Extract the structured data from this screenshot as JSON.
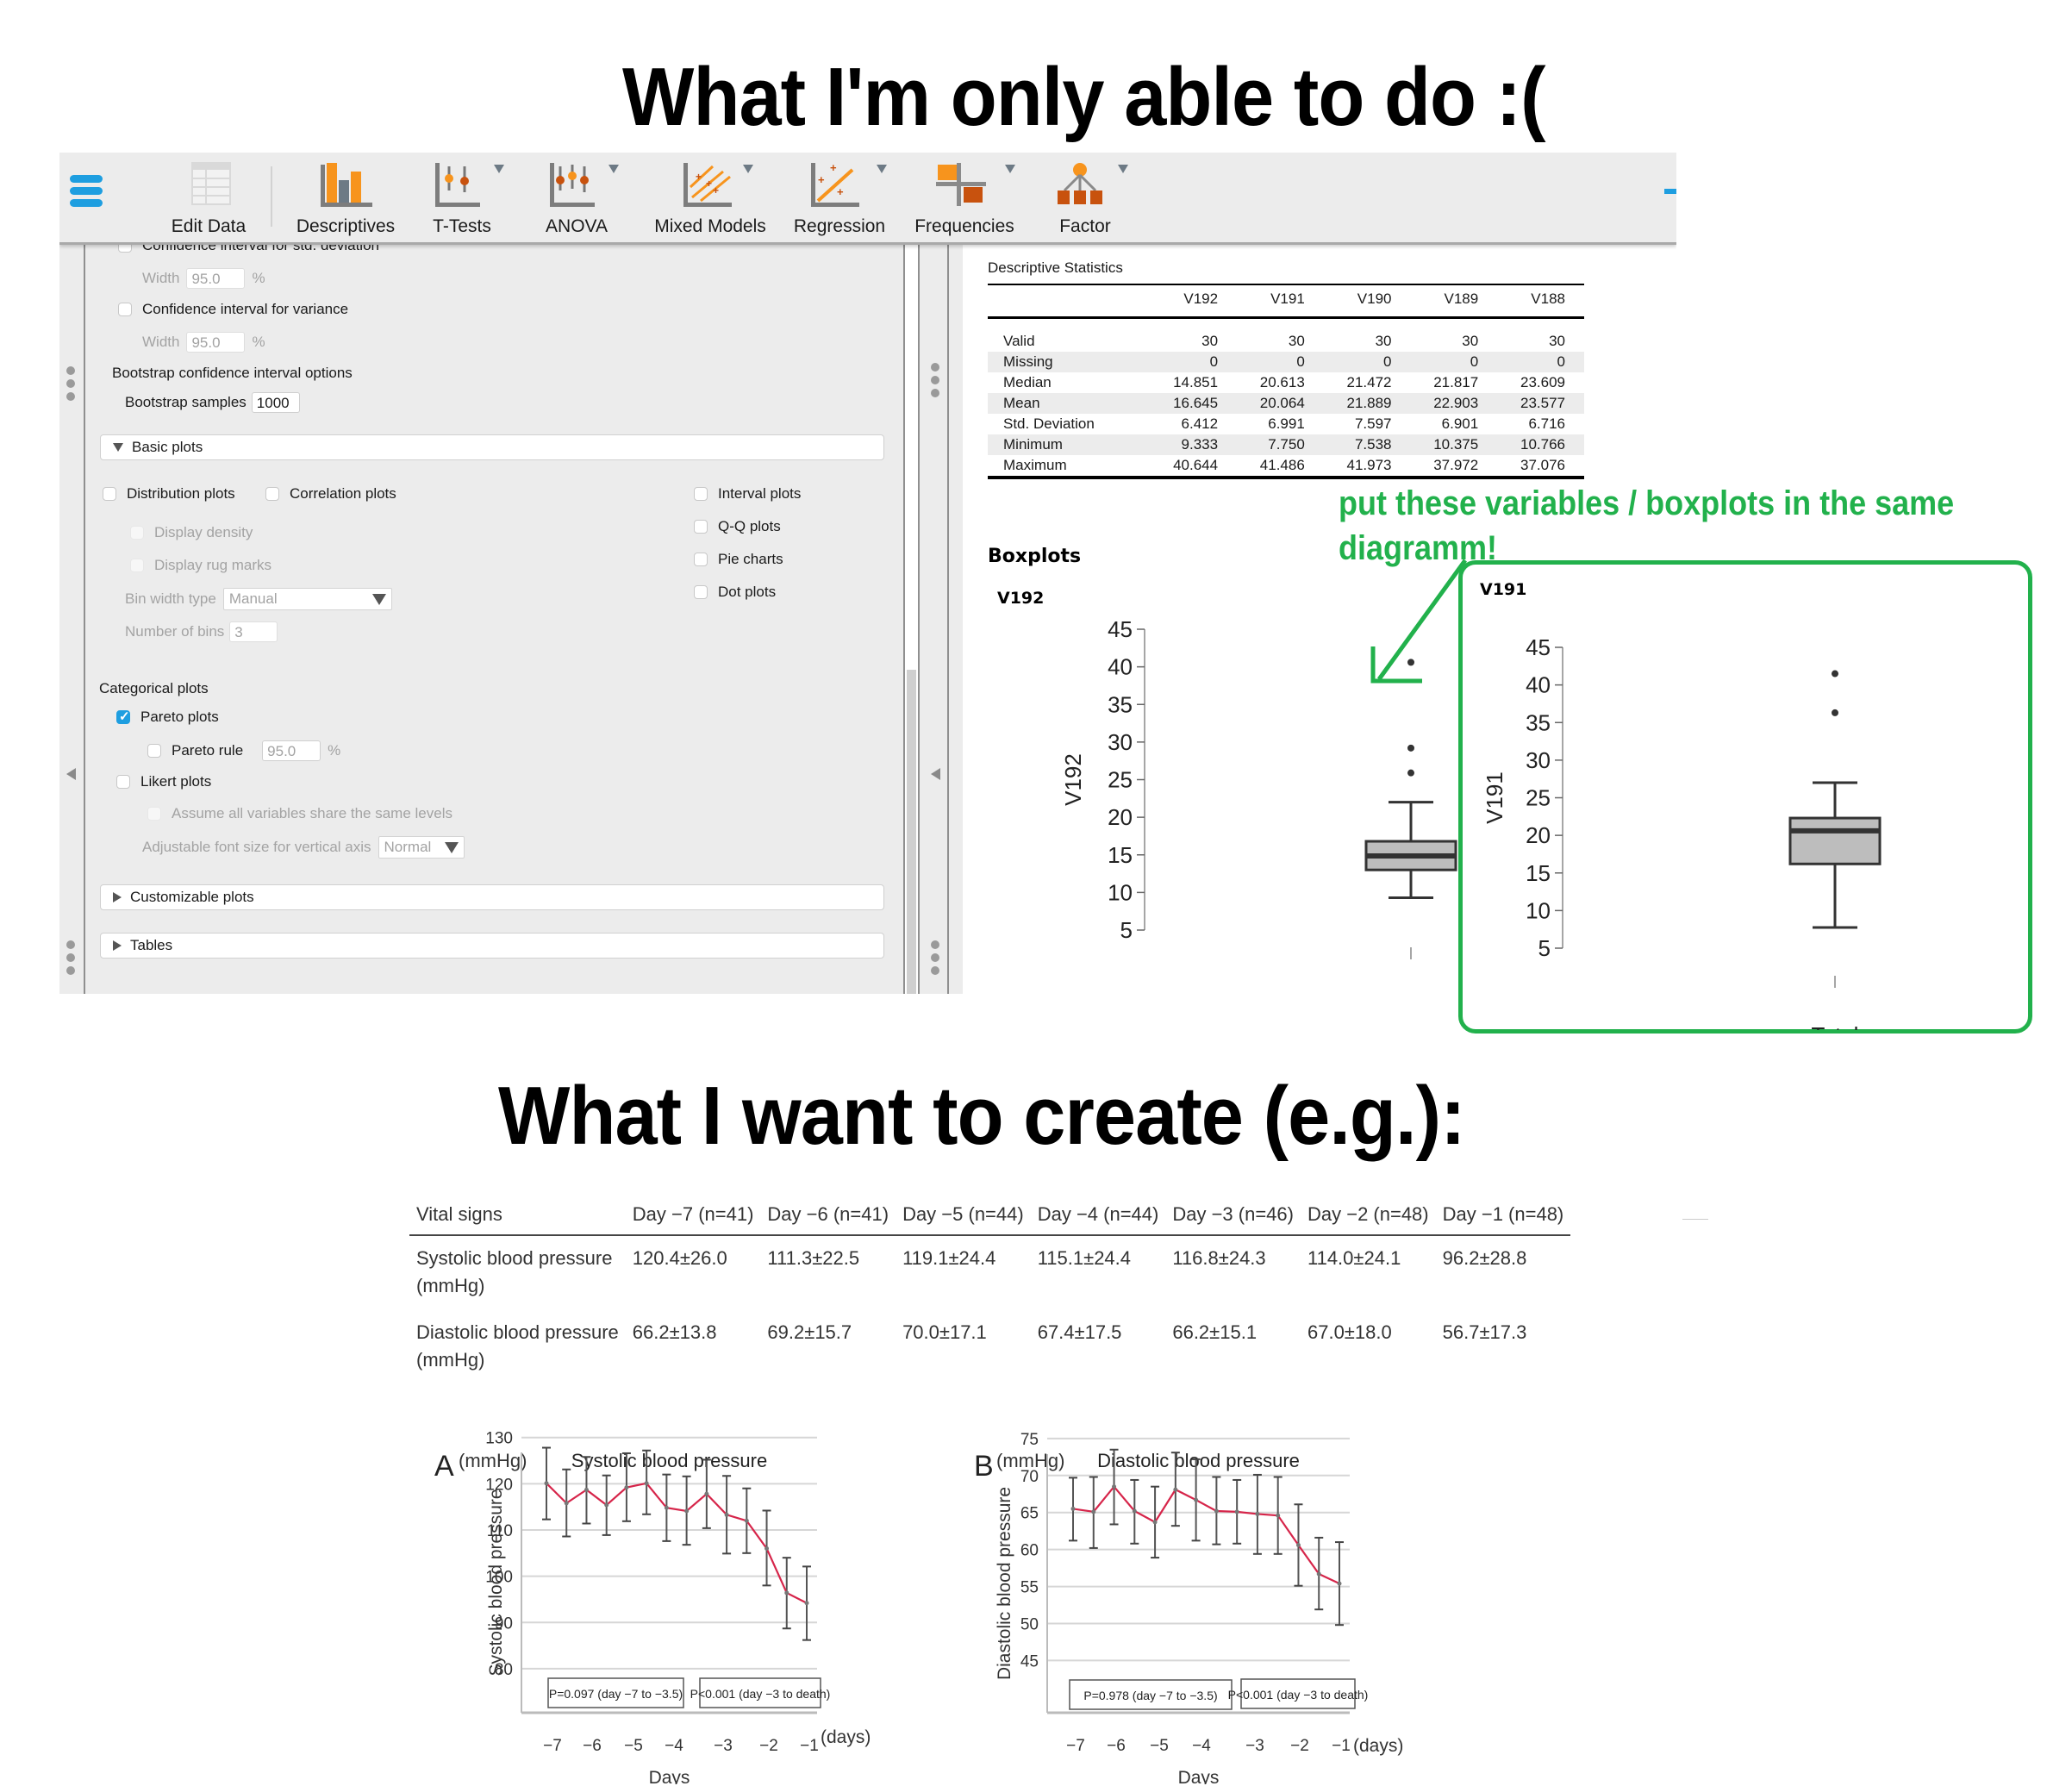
{
  "titles": {
    "top": "What I'm only able to do :(",
    "bottom": "What I want to create (e.g.):"
  },
  "toolbar": {
    "menu_icon": "hamburger-menu-icon",
    "items": [
      {
        "label": "Edit Data",
        "icon": "edit-data-grid-icon",
        "has_menu": false
      },
      {
        "label": "Descriptives",
        "icon": "descriptives-bar-icon",
        "has_menu": false
      },
      {
        "label": "T-Tests",
        "icon": "t-tests-icon",
        "has_menu": true
      },
      {
        "label": "ANOVA",
        "icon": "anova-icon",
        "has_menu": true
      },
      {
        "label": "Mixed Models",
        "icon": "mixed-models-icon",
        "has_menu": true
      },
      {
        "label": "Regression",
        "icon": "regression-icon",
        "has_menu": true
      },
      {
        "label": "Frequencies",
        "icon": "frequencies-icon",
        "has_menu": true
      },
      {
        "label": "Factor",
        "icon": "factor-icon",
        "has_menu": true
      }
    ]
  },
  "options": {
    "ci_std_dev": {
      "label": "Confidence interval for std. deviation",
      "checked": false
    },
    "ci_std_dev_width": {
      "label": "Width",
      "value": "95.0",
      "unit": "%"
    },
    "ci_variance": {
      "label": "Confidence interval for variance",
      "checked": false
    },
    "ci_variance_width": {
      "label": "Width",
      "value": "95.0",
      "unit": "%"
    },
    "bootstrap_heading": "Bootstrap confidence interval options",
    "bootstrap_samples": {
      "label": "Bootstrap samples",
      "value": "1000"
    },
    "basic_plots": {
      "label": "Basic plots",
      "distribution_plots": "Distribution plots",
      "correlation_plots": "Correlation plots",
      "interval_plots": "Interval plots",
      "qq_plots": "Q-Q plots",
      "pie_charts": "Pie charts",
      "dot_plots": "Dot plots",
      "display_density": "Display density",
      "display_rug_marks": "Display rug marks",
      "bin_width_type": {
        "label": "Bin width type",
        "value": "Manual"
      },
      "number_of_bins": {
        "label": "Number of bins",
        "value": "3"
      }
    },
    "categorical_plots": {
      "heading": "Categorical plots",
      "pareto_plots": {
        "label": "Pareto plots",
        "checked": true
      },
      "pareto_rule": {
        "label": "Pareto rule",
        "value": "95.0",
        "unit": "%"
      },
      "likert_plots": {
        "label": "Likert plots",
        "checked": false
      },
      "assume_same_levels": "Assume all variables share the same levels",
      "font_size_vertical": {
        "label": "Adjustable font size for vertical axis",
        "value": "Normal"
      }
    },
    "customizable_plots": "Customizable plots",
    "tables": "Tables"
  },
  "results": {
    "table_title": "Descriptive Statistics",
    "columns": [
      "",
      "V192",
      "V191",
      "V190",
      "V189",
      "V188"
    ],
    "rows": [
      [
        "Valid",
        "30",
        "30",
        "30",
        "30",
        "30"
      ],
      [
        "Missing",
        "0",
        "0",
        "0",
        "0",
        "0"
      ],
      [
        "Median",
        "14.851",
        "20.613",
        "21.472",
        "21.817",
        "23.609"
      ],
      [
        "Mean",
        "16.645",
        "20.064",
        "21.889",
        "22.903",
        "23.577"
      ],
      [
        "Std. Deviation",
        "6.412",
        "6.991",
        "7.597",
        "6.901",
        "6.716"
      ],
      [
        "Minimum",
        "9.333",
        "7.750",
        "7.538",
        "10.375",
        "10.766"
      ],
      [
        "Maximum",
        "40.644",
        "41.486",
        "41.973",
        "37.972",
        "37.076"
      ]
    ],
    "boxplots_heading": "Boxplots",
    "annotation": {
      "line1": "put these variables / boxplots in the same",
      "line2": "diagramm!",
      "color": "#22b14c"
    }
  },
  "vital_table": {
    "columns": [
      "Vital signs",
      "Day −7 (n=41)",
      "Day −6 (n=41)",
      "Day −5 (n=44)",
      "Day −4 (n=44)",
      "Day −3 (n=46)",
      "Day −2 (n=48)",
      "Day −1 (n=48)"
    ],
    "rows": [
      {
        "label1": "Systolic blood pressure",
        "label2": "(mmHg)",
        "values": [
          "120.4±26.0",
          "111.3±22.5",
          "119.1±24.4",
          "115.1±24.4",
          "116.8±24.3",
          "114.0±24.1",
          "96.2±28.8"
        ]
      },
      {
        "label1": "Diastolic blood pressure",
        "label2": "(mmHg)",
        "values": [
          "66.2±13.8",
          "69.2±15.7",
          "70.0±17.1",
          "67.4±17.5",
          "66.2±15.1",
          "67.0±18.0",
          "56.7±17.3"
        ]
      }
    ]
  },
  "chart_data": [
    {
      "id": "boxplot-v192",
      "type": "boxplot",
      "title": "V192",
      "ylabel": "V192",
      "xlabel": "",
      "yticks": [
        5,
        10,
        15,
        20,
        25,
        30,
        35,
        40,
        45
      ],
      "ylim": [
        5,
        45
      ],
      "box": {
        "whisker_low": 9.3,
        "q1": 13.0,
        "median": 14.85,
        "q3": 16.8,
        "whisker_high": 22.0
      },
      "outliers": [
        25.9,
        29.2,
        40.6
      ]
    },
    {
      "id": "boxplot-v191",
      "type": "boxplot",
      "title": "V191",
      "ylabel": "V191",
      "xlabel": "Total",
      "yticks": [
        5,
        10,
        15,
        20,
        25,
        30,
        35,
        40,
        45
      ],
      "ylim": [
        5,
        45
      ],
      "box": {
        "whisker_low": 7.75,
        "q1": 16.2,
        "median": 20.6,
        "q3": 22.3,
        "whisker_high": 27.0
      },
      "outliers": [
        36.3,
        41.5
      ]
    },
    {
      "id": "chart-a",
      "type": "line",
      "panel_label": "A",
      "unit_label": "(mmHg)",
      "title": "Systolic blood pressure",
      "ylabel": "Systolic blood pressure",
      "xlabel": "Days",
      "x_unit": "(days)",
      "xticks": [
        "−7",
        "−6",
        "−5",
        "−4",
        "−3",
        "−2",
        "−1"
      ],
      "yticks": [
        80,
        90,
        100,
        110,
        120,
        130
      ],
      "ylim": [
        77,
        132
      ],
      "grid": true,
      "series": [
        {
          "name": "Systolic blood pressure",
          "color": "#d6254a",
          "values": [
            120.1,
            115.8,
            118.7,
            115.4,
            119.2,
            120.1,
            114.8,
            114.1,
            117.8,
            113.3,
            112.0,
            106.0,
            96.4,
            94.2
          ],
          "err_high": [
            127.8,
            123.1,
            125.8,
            121.8,
            126.6,
            127.2,
            122.0,
            121.6,
            125.2,
            121.7,
            119.0,
            114.2,
            104.0,
            102.1
          ],
          "err_low": [
            112.3,
            108.6,
            111.4,
            108.9,
            111.9,
            113.4,
            107.6,
            106.8,
            110.4,
            104.9,
            105.0,
            98.0,
            88.7,
            86.2
          ]
        }
      ],
      "annotations": [
        "P=0.097 (day −7 to −3.5)",
        "P<0.001 (day −3 to death)"
      ]
    },
    {
      "id": "chart-b",
      "type": "line",
      "panel_label": "B",
      "unit_label": "(mmHg)",
      "title": "Diastolic blood pressure",
      "ylabel": "Diastolic blood pressure",
      "xlabel": "Days",
      "x_unit": "(days)",
      "xticks": [
        "−7",
        "−6",
        "−5",
        "−4",
        "−3",
        "−2",
        "−1"
      ],
      "yticks": [
        45,
        50,
        55,
        60,
        65,
        70,
        75
      ],
      "ylim": [
        43.3,
        76.5
      ],
      "grid": true,
      "series": [
        {
          "name": "Diastolic blood pressure",
          "color": "#d6254a",
          "values": [
            65.5,
            65.1,
            68.5,
            65.2,
            63.7,
            68.1,
            66.7,
            65.2,
            65.1,
            64.8,
            64.6,
            60.6,
            56.7,
            55.4
          ],
          "err_high": [
            69.7,
            69.8,
            73.5,
            69.4,
            68.5,
            73.1,
            72.2,
            69.8,
            69.4,
            70.1,
            69.8,
            66.1,
            61.6,
            61.0
          ],
          "err_low": [
            61.2,
            60.2,
            63.4,
            60.8,
            58.9,
            63.2,
            61.2,
            60.7,
            60.8,
            59.4,
            59.4,
            55.1,
            51.9,
            49.8
          ]
        }
      ],
      "annotations": [
        "P=0.978 (day −7 to −3.5)",
        "P<0.001 (day −3 to death)"
      ]
    }
  ]
}
